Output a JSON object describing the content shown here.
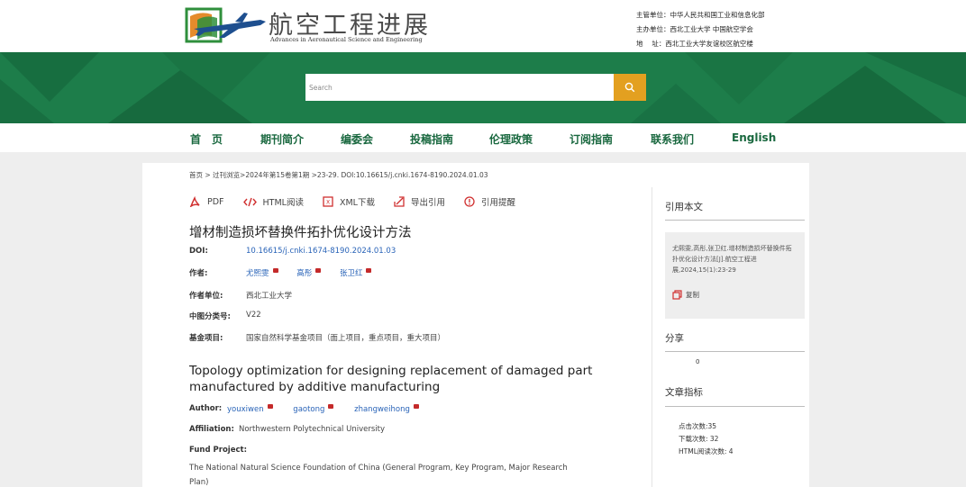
{
  "header": {
    "logo_title": "航空工程进展",
    "logo_subtitle": "Advances in Aeronautical Science and Engineering",
    "org_lines": [
      "主管单位：中华人民共和国工业和信息化部",
      "主办单位：西北工业大学  中国航空学会",
      "地　 址：西北工业大学友谊校区航空楼"
    ]
  },
  "search": {
    "placeholder": "Search"
  },
  "nav": {
    "items": [
      "首　页",
      "期刊简介",
      "编委会",
      "投稿指南",
      "伦理政策",
      "订阅指南",
      "联系我们",
      "English"
    ]
  },
  "breadcrumb": "首页 > 过刊浏览>2024年第15卷第1期 >23-29. DOI:10.16615/j.cnki.1674-8190.2024.01.03",
  "toolbar": {
    "pdf": "PDF",
    "html": "HTML阅读",
    "xml": "XML下载",
    "export": "导出引用",
    "alert": "引用提醒"
  },
  "article": {
    "title_cn": "增材制造损坏替换件拓扑优化设计方法",
    "doi_label": "DOI:",
    "doi": "10.16615/j.cnki.1674-8190.2024.01.03",
    "authors_label": "作者:",
    "authors_cn": [
      "尤熙雯",
      "高彤",
      "张卫红"
    ],
    "affiliation_label": "作者单位:",
    "affiliation_cn": "西北工业大学",
    "clc_label": "中图分类号:",
    "clc": "V22",
    "fund_label": "基金项目:",
    "fund_cn": "国家自然科学基金项目（面上项目，重点项目，重大项目）",
    "title_en": "Topology optimization for designing replacement of damaged part manufactured by additive manufacturing",
    "author_label_en": "Author:",
    "authors_en": [
      "youxiwen",
      "gaotong",
      "zhangweihong"
    ],
    "affiliation_label_en": "Affiliation:",
    "affiliation_en": "Northwestern Polytechnical University",
    "fund_label_en": "Fund Project:",
    "fund_en": "The National Natural Science Foundation of China (General Program, Key Program, Major Research Plan)"
  },
  "sidebar": {
    "cite_heading": "引用本文",
    "cite_text": "尤熙雯,高彤,张卫红.增材制造损坏替换件拓扑优化设计方法[J].航空工程进展,2024,15(1):23-29",
    "copy_label": "复制",
    "share_heading": "分享",
    "share_count": "0",
    "metrics_heading": "文章指标",
    "metrics": [
      "点击次数:35",
      "下载次数: 32",
      "HTML阅读次数: 4"
    ]
  },
  "colors": {
    "brand_green": "#1d7d4a",
    "nav_text": "#19683f",
    "search_button": "#e3a020",
    "link_blue": "#2a64b8",
    "mail_red": "#c42a2a"
  }
}
